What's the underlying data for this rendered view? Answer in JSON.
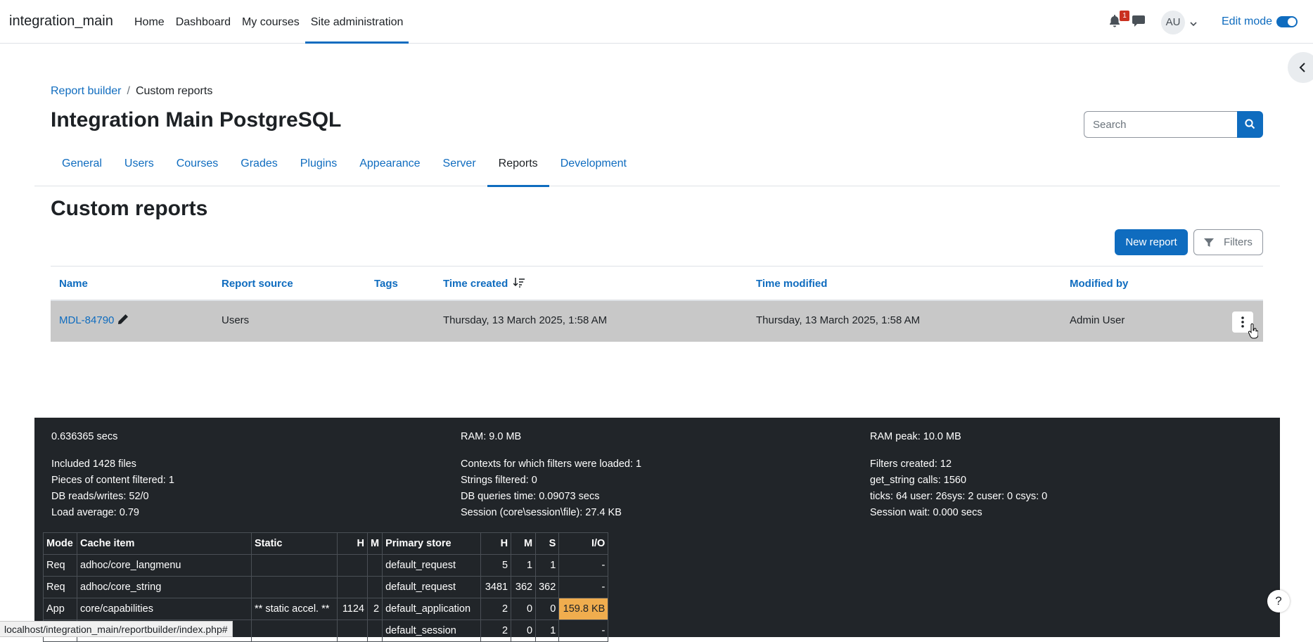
{
  "navbar": {
    "brand": "integration_main",
    "links": [
      "Home",
      "Dashboard",
      "My courses",
      "Site administration"
    ],
    "active_link": "Site administration",
    "notification_count": "1",
    "avatar_initials": "AU",
    "edit_mode_label": "Edit mode",
    "edit_mode_on": true
  },
  "breadcrumb": {
    "items": [
      "Report builder",
      "Custom reports"
    ],
    "separator": "/"
  },
  "page_title": "Integration Main PostgreSQL",
  "search": {
    "placeholder": "Search"
  },
  "tabs": [
    "General",
    "Users",
    "Courses",
    "Grades",
    "Plugins",
    "Appearance",
    "Server",
    "Reports",
    "Development"
  ],
  "active_tab": "Reports",
  "section_title": "Custom reports",
  "buttons": {
    "new_report": "New report",
    "filters": "Filters"
  },
  "table": {
    "headers": [
      "Name",
      "Report source",
      "Tags",
      "Time created",
      "Time modified",
      "Modified by"
    ],
    "rows": [
      {
        "name": "MDL-84790",
        "source": "Users",
        "tags": "",
        "created": "Thursday, 13 March 2025, 1:58 AM",
        "modified": "Thursday, 13 March 2025, 1:58 AM",
        "modified_by": "Admin User"
      }
    ]
  },
  "footer": {
    "col1": [
      "0.636365 secs",
      "Included 1428 files",
      "Pieces of content filtered: 1",
      "DB reads/writes: 52/0",
      "Load average: 0.79"
    ],
    "col2": [
      "RAM: 9.0 MB",
      "Contexts for which filters were loaded: 1",
      "Strings filtered: 0",
      "DB queries time: 0.09073 secs",
      "Session (core\\session\\file): 27.4 KB"
    ],
    "col3": [
      "RAM peak: 10.0 MB",
      "Filters created: 12",
      "get_string calls: 1560",
      "ticks: 64 user: 26sys: 2 cuser: 0 csys: 0",
      "Session wait: 0.000 secs"
    ],
    "cache_table": {
      "headers": [
        "Mode",
        "Cache item",
        "Static",
        "H",
        "M",
        "Primary store",
        "H",
        "M",
        "S",
        "I/O"
      ],
      "rows": [
        [
          "Req",
          "adhoc/core_langmenu",
          "",
          "",
          "",
          "default_request",
          "5",
          "1",
          "1",
          "-"
        ],
        [
          "Req",
          "adhoc/core_string",
          "",
          "",
          "",
          "default_request",
          "3481",
          "362",
          "362",
          "-"
        ],
        [
          "App",
          "core/capabilities",
          "** static accel. **",
          "1124",
          "2",
          "default_application",
          "2",
          "0",
          "0",
          "159.8 KB"
        ],
        [
          "",
          "",
          "",
          "",
          "",
          "default_session",
          "2",
          "0",
          "1",
          "-"
        ]
      ]
    }
  },
  "status_bar": "localhost/integration_main/reportbuilder/index.php#",
  "help_label": "?"
}
